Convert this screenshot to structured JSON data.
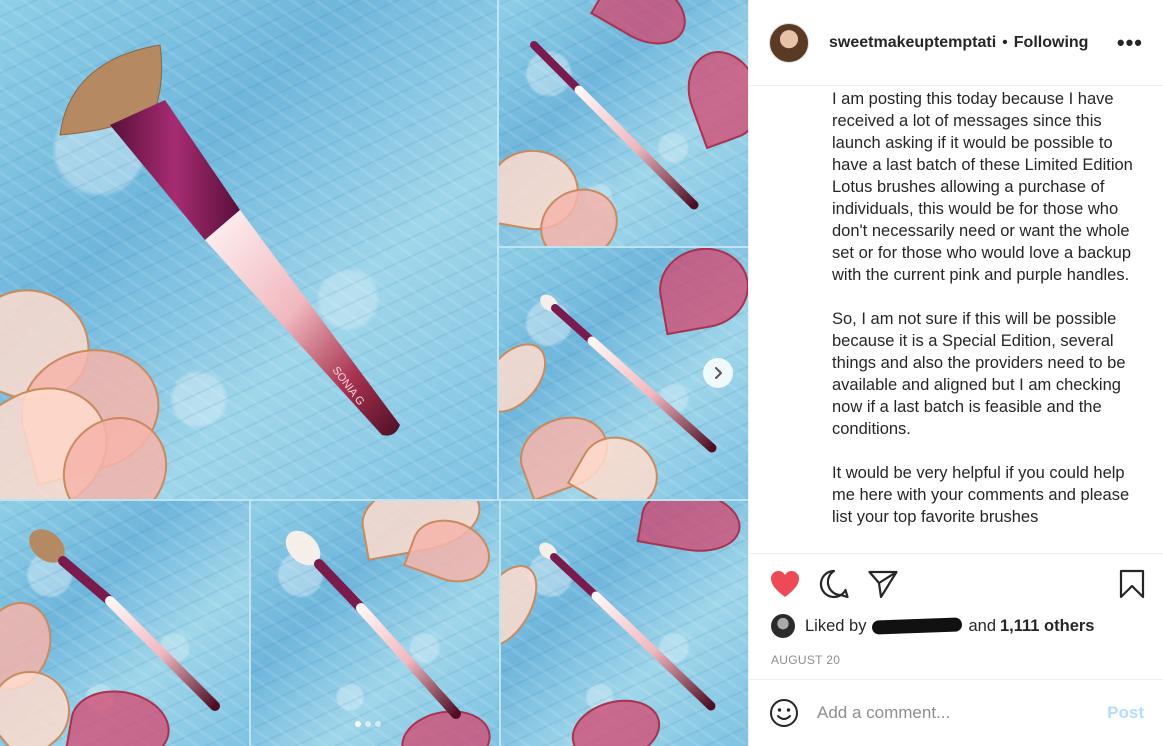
{
  "post": {
    "username": "sweetmakeuptemptati",
    "separator": "•",
    "follow_status": "Following",
    "more_label": "•••"
  },
  "caption": {
    "paragraphs": [
      "I am posting this today because I have received a lot of messages since this launch asking if it would be possible to have a last batch of these Limited Edition Lotus brushes allowing a purchase of individuals, this would be for those who don't necessarily need or want the whole set or for those who would love a backup with the current pink and purple handles.",
      "So, I am not sure if this will be possible because it is a Special Edition, several things and also the providers need to be available and aligned but I am checking now if a last batch is feasible and the conditions.",
      "It would be very helpful if you could help me here with your comments and please list your top favorite brushes"
    ]
  },
  "brand_mark": "SONIA G",
  "engagement": {
    "liked_by_prefix": "Liked by",
    "and_text": "and",
    "others_count": "1,111 others",
    "date": "AUGUST 20"
  },
  "comment": {
    "placeholder": "Add a comment...",
    "post_label": "Post"
  },
  "carousel": {
    "total_slides": 3,
    "active_slide": 1
  },
  "colors": {
    "like_red": "#ed4956",
    "post_disabled": "#b2dffc",
    "muted_text": "#8e8e8e",
    "brush_plum": "#7a1b4e"
  },
  "icons": [
    "heart-icon",
    "comment-icon",
    "share-icon",
    "bookmark-icon",
    "more-icon",
    "emoji-icon",
    "chevron-right-icon"
  ]
}
